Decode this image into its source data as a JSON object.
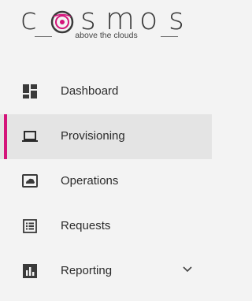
{
  "brand": {
    "name": "cosmos",
    "tagline": "above the clouds"
  },
  "nav": {
    "items": [
      {
        "label": "Dashboard",
        "icon": "dashboard-icon",
        "active": false
      },
      {
        "label": "Provisioning",
        "icon": "laptop-icon",
        "active": true
      },
      {
        "label": "Operations",
        "icon": "cloud-icon",
        "active": false
      },
      {
        "label": "Requests",
        "icon": "list-icon",
        "active": false
      },
      {
        "label": "Reporting",
        "icon": "chart-icon",
        "active": false,
        "expandable": true
      }
    ]
  },
  "colors": {
    "accent": "#d4147a",
    "active_bg": "#e4e4e4",
    "icon": "#3a3a3a"
  }
}
